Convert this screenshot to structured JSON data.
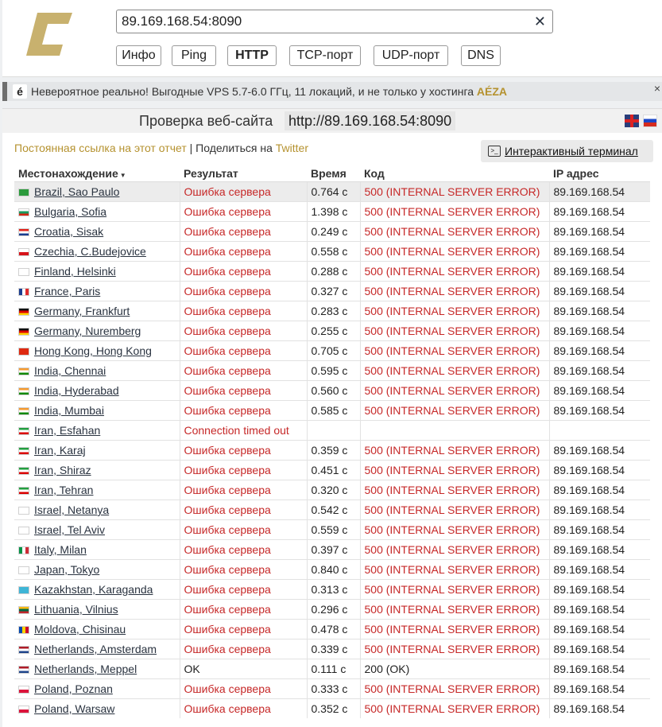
{
  "search": {
    "value": "89.169.168.54:8090"
  },
  "nav": [
    {
      "label": "Инфо",
      "active": false
    },
    {
      "label": "Ping",
      "active": false
    },
    {
      "label": "HTTP",
      "active": true
    },
    {
      "label": "TCP-порт",
      "active": false
    },
    {
      "label": "UDP-порт",
      "active": false
    },
    {
      "label": "DNS",
      "active": false
    }
  ],
  "banner": {
    "icon_glyph": "é",
    "text": "Невероятное реально! Выгодные VPS 5.7-6.0 ГГц, 11 локаций, и не только у хостинга ",
    "brand": "AÉZA",
    "close": "×"
  },
  "report": {
    "title": "Проверка веб-сайта",
    "url": "http://89.169.168.54:8090",
    "permalink": "Постоянная ссылка на этот отчет",
    "separator": " | Поделиться на ",
    "share": "Twitter",
    "terminal_button": "Интерактивный терминал"
  },
  "colors": {
    "accent": "#b5922f",
    "error": "#c62828",
    "link": "#2a3340"
  },
  "table": {
    "headers": [
      "Местонахождение",
      "Результат",
      "Время",
      "Код",
      "IP адрес"
    ],
    "rows": [
      {
        "flag": "br",
        "location": "Brazil, Sao Paulo",
        "result": "Ошибка сервера",
        "time": "0.764 с",
        "code": "500 (INTERNAL SERVER ERROR)",
        "ip": "89.169.168.54",
        "status": "error"
      },
      {
        "flag": "bg",
        "location": "Bulgaria, Sofia",
        "result": "Ошибка сервера",
        "time": "1.398 с",
        "code": "500 (INTERNAL SERVER ERROR)",
        "ip": "89.169.168.54",
        "status": "error"
      },
      {
        "flag": "hr",
        "location": "Croatia, Sisak",
        "result": "Ошибка сервера",
        "time": "0.249 с",
        "code": "500 (INTERNAL SERVER ERROR)",
        "ip": "89.169.168.54",
        "status": "error"
      },
      {
        "flag": "cz",
        "location": "Czechia, C.Budejovice",
        "result": "Ошибка сервера",
        "time": "0.558 с",
        "code": "500 (INTERNAL SERVER ERROR)",
        "ip": "89.169.168.54",
        "status": "error"
      },
      {
        "flag": "fi",
        "location": "Finland, Helsinki",
        "result": "Ошибка сервера",
        "time": "0.288 с",
        "code": "500 (INTERNAL SERVER ERROR)",
        "ip": "89.169.168.54",
        "status": "error"
      },
      {
        "flag": "fr",
        "location": "France, Paris",
        "result": "Ошибка сервера",
        "time": "0.327 с",
        "code": "500 (INTERNAL SERVER ERROR)",
        "ip": "89.169.168.54",
        "status": "error"
      },
      {
        "flag": "de",
        "location": "Germany, Frankfurt",
        "result": "Ошибка сервера",
        "time": "0.283 с",
        "code": "500 (INTERNAL SERVER ERROR)",
        "ip": "89.169.168.54",
        "status": "error"
      },
      {
        "flag": "de",
        "location": "Germany, Nuremberg",
        "result": "Ошибка сервера",
        "time": "0.255 с",
        "code": "500 (INTERNAL SERVER ERROR)",
        "ip": "89.169.168.54",
        "status": "error"
      },
      {
        "flag": "hk",
        "location": "Hong Kong, Hong Kong",
        "result": "Ошибка сервера",
        "time": "0.705 с",
        "code": "500 (INTERNAL SERVER ERROR)",
        "ip": "89.169.168.54",
        "status": "error"
      },
      {
        "flag": "in",
        "location": "India, Chennai",
        "result": "Ошибка сервера",
        "time": "0.595 с",
        "code": "500 (INTERNAL SERVER ERROR)",
        "ip": "89.169.168.54",
        "status": "error"
      },
      {
        "flag": "in",
        "location": "India, Hyderabad",
        "result": "Ошибка сервера",
        "time": "0.560 с",
        "code": "500 (INTERNAL SERVER ERROR)",
        "ip": "89.169.168.54",
        "status": "error"
      },
      {
        "flag": "in",
        "location": "India, Mumbai",
        "result": "Ошибка сервера",
        "time": "0.585 с",
        "code": "500 (INTERNAL SERVER ERROR)",
        "ip": "89.169.168.54",
        "status": "error"
      },
      {
        "flag": "ir",
        "location": "Iran, Esfahan",
        "result": "Connection timed out",
        "time": "",
        "code": "",
        "ip": "",
        "status": "error"
      },
      {
        "flag": "ir",
        "location": "Iran, Karaj",
        "result": "Ошибка сервера",
        "time": "0.359 с",
        "code": "500 (INTERNAL SERVER ERROR)",
        "ip": "89.169.168.54",
        "status": "error"
      },
      {
        "flag": "ir",
        "location": "Iran, Shiraz",
        "result": "Ошибка сервера",
        "time": "0.451 с",
        "code": "500 (INTERNAL SERVER ERROR)",
        "ip": "89.169.168.54",
        "status": "error"
      },
      {
        "flag": "ir",
        "location": "Iran, Tehran",
        "result": "Ошибка сервера",
        "time": "0.320 с",
        "code": "500 (INTERNAL SERVER ERROR)",
        "ip": "89.169.168.54",
        "status": "error"
      },
      {
        "flag": "il",
        "location": "Israel, Netanya",
        "result": "Ошибка сервера",
        "time": "0.542 с",
        "code": "500 (INTERNAL SERVER ERROR)",
        "ip": "89.169.168.54",
        "status": "error"
      },
      {
        "flag": "il",
        "location": "Israel, Tel Aviv",
        "result": "Ошибка сервера",
        "time": "0.559 с",
        "code": "500 (INTERNAL SERVER ERROR)",
        "ip": "89.169.168.54",
        "status": "error"
      },
      {
        "flag": "it",
        "location": "Italy, Milan",
        "result": "Ошибка сервера",
        "time": "0.397 с",
        "code": "500 (INTERNAL SERVER ERROR)",
        "ip": "89.169.168.54",
        "status": "error"
      },
      {
        "flag": "jp",
        "location": "Japan, Tokyo",
        "result": "Ошибка сервера",
        "time": "0.840 с",
        "code": "500 (INTERNAL SERVER ERROR)",
        "ip": "89.169.168.54",
        "status": "error"
      },
      {
        "flag": "kz",
        "location": "Kazakhstan, Karaganda",
        "result": "Ошибка сервера",
        "time": "0.313 с",
        "code": "500 (INTERNAL SERVER ERROR)",
        "ip": "89.169.168.54",
        "status": "error"
      },
      {
        "flag": "lt",
        "location": "Lithuania, Vilnius",
        "result": "Ошибка сервера",
        "time": "0.296 с",
        "code": "500 (INTERNAL SERVER ERROR)",
        "ip": "89.169.168.54",
        "status": "error"
      },
      {
        "flag": "md",
        "location": "Moldova, Chisinau",
        "result": "Ошибка сервера",
        "time": "0.478 с",
        "code": "500 (INTERNAL SERVER ERROR)",
        "ip": "89.169.168.54",
        "status": "error"
      },
      {
        "flag": "nl",
        "location": "Netherlands, Amsterdam",
        "result": "Ошибка сервера",
        "time": "0.339 с",
        "code": "500 (INTERNAL SERVER ERROR)",
        "ip": "89.169.168.54",
        "status": "error"
      },
      {
        "flag": "nl",
        "location": "Netherlands, Meppel",
        "result": "OK",
        "time": "0.111 с",
        "code": "200 (OK)",
        "ip": "89.169.168.54",
        "status": "ok"
      },
      {
        "flag": "pl",
        "location": "Poland, Poznan",
        "result": "Ошибка сервера",
        "time": "0.333 с",
        "code": "500 (INTERNAL SERVER ERROR)",
        "ip": "89.169.168.54",
        "status": "error"
      },
      {
        "flag": "pl",
        "location": "Poland, Warsaw",
        "result": "Ошибка сервера",
        "time": "0.352 с",
        "code": "500 (INTERNAL SERVER ERROR)",
        "ip": "89.169.168.54",
        "status": "error"
      }
    ]
  }
}
